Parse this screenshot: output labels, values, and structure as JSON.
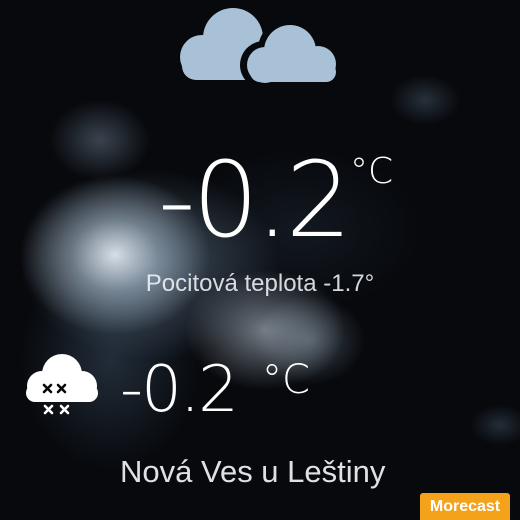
{
  "current": {
    "temperature": "-0.2",
    "unit": "°C",
    "feels_like": "Pocitová teplota -1.7°",
    "icon": "cloudy-icon",
    "icon_color": "#a8c1d6"
  },
  "forecast": {
    "temperature": "-0.2",
    "unit": "°C",
    "icon": "snow-cloud-icon"
  },
  "location": "Nová Ves u Leštiny",
  "brand": {
    "label": "Morecast",
    "color": "#f4a21a"
  }
}
